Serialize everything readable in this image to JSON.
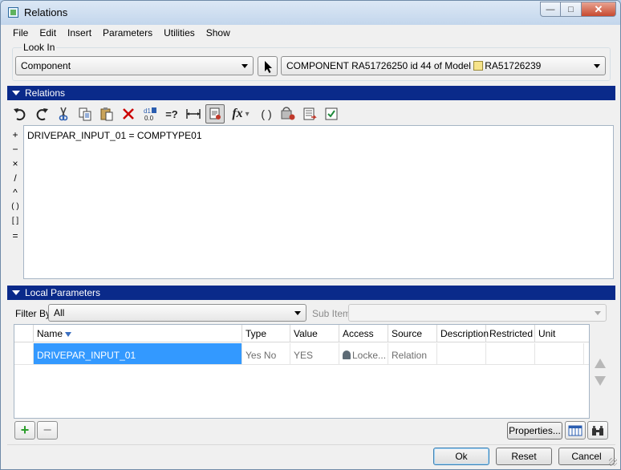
{
  "window": {
    "title": "Relations",
    "minimize_glyph": "—",
    "maximize_glyph": "□",
    "close_glyph": "✕"
  },
  "menu": [
    "File",
    "Edit",
    "Insert",
    "Parameters",
    "Utilities",
    "Show"
  ],
  "look_in": {
    "label": "Look In",
    "type_value": "Component",
    "object_prefix": "COMPONENT RA51726250 id 44 of Model",
    "object_model": "RA51726239"
  },
  "relations_section": {
    "header": "Relations",
    "operators": [
      "+",
      "−",
      "×",
      "/",
      "^",
      "( )",
      "[ ]",
      "="
    ],
    "editor_text": "DRIVEPAR_INPUT_01 = COMPTYPE01"
  },
  "toolbar": {
    "sort_label": "=?",
    "fx_label": "fx",
    "fx_arrow": "▾",
    "brackets_label": "( )"
  },
  "local_params": {
    "header": "Local Parameters",
    "filter_label": "Filter By",
    "filter_value": "All",
    "subitems_label": "Sub Items",
    "columns": [
      "Name",
      "Type",
      "Value",
      "Access",
      "Source",
      "Description",
      "Restricted",
      "Unit"
    ],
    "rows": [
      {
        "name": "DRIVEPAR_INPUT_01",
        "type": "Yes No",
        "value": "YES",
        "access": "Locke...",
        "source": "Relation",
        "description": "",
        "restricted": "",
        "unit": ""
      }
    ]
  },
  "buttons": {
    "add": "+",
    "remove": "−",
    "properties": "Properties...",
    "ok": "Ok",
    "reset": "Reset",
    "cancel": "Cancel"
  },
  "colors": {
    "section_header_bg": "#0a2a8a",
    "selection": "#3399ff",
    "add_green": "#2a9d2a"
  }
}
